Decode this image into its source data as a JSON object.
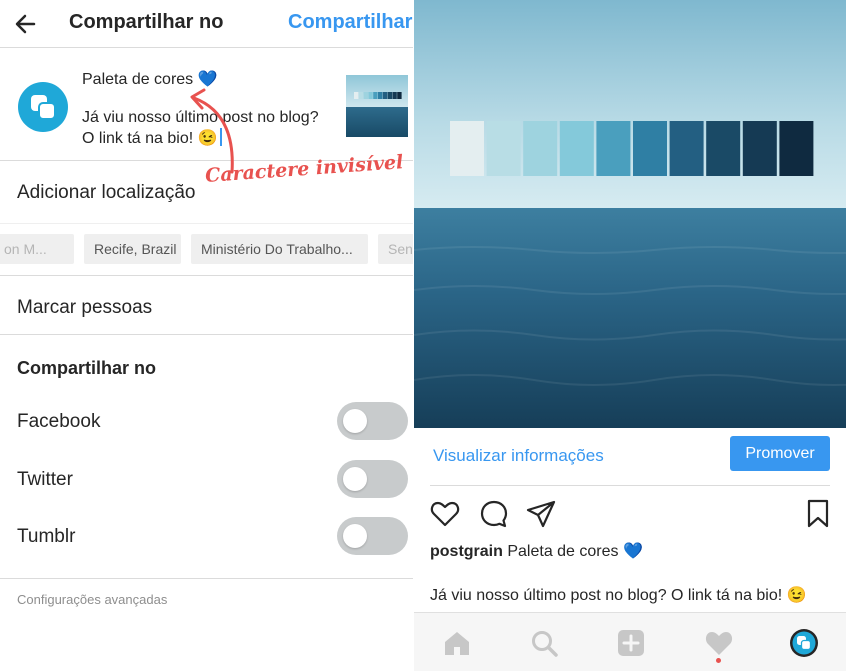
{
  "share_screen": {
    "title": "Compartilhar no",
    "share_action": "Compartilhar",
    "caption_line1": "Paleta de cores 💙",
    "caption_line2": "Já viu nosso último post no blog?",
    "caption_line3": "O link tá na bio! 😉",
    "add_location": "Adicionar localização",
    "annotation": "Caractere invisível",
    "location_chips": [
      "on M...",
      "Recife, Brazil",
      "Ministério Do Trabalho...",
      "Sen"
    ],
    "tag_people": "Marcar pessoas",
    "share_heading": "Compartilhar no",
    "networks": [
      "Facebook",
      "Twitter",
      "Tumblr"
    ],
    "advanced_settings": "Configurações avançadas"
  },
  "post_screen": {
    "view_insights": "Visualizar informações",
    "promote": "Promover",
    "username": "postgrain",
    "caption_title": "Paleta de cores 💙",
    "caption_body": "Já viu nosso último post no blog? O link tá na bio! 😉"
  },
  "palette": [
    "#e4eef0",
    "#b8dde5",
    "#9ed3df",
    "#84c9da",
    "#4a9fbe",
    "#2f7fa4",
    "#235f82",
    "#1a4a66",
    "#153a54",
    "#0f2a40"
  ],
  "colors": {
    "accent": "#3897f0",
    "annotation": "#e8524f",
    "toggle_off": "#c8cbcc"
  }
}
